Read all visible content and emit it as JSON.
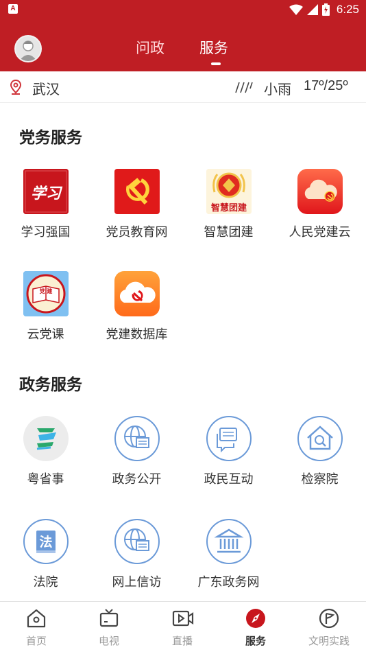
{
  "status_bar": {
    "time": "6:25",
    "app_icon": "A"
  },
  "nav": {
    "tabs": [
      {
        "label": "问政",
        "active": false
      },
      {
        "label": "服务",
        "active": true
      }
    ]
  },
  "location": {
    "city": "武汉"
  },
  "weather": {
    "desc": "小雨",
    "temp": "17º/25º"
  },
  "sections": [
    {
      "title": "党务服务",
      "items": [
        {
          "label": "学习强国",
          "icon": "xuexi-qiangguo-icon",
          "icon_text": "学习"
        },
        {
          "label": "党员教育网",
          "icon": "party-emblem-icon"
        },
        {
          "label": "智慧团建",
          "icon": "youth-league-icon",
          "icon_text": "智慧团建"
        },
        {
          "label": "人民党建云",
          "icon": "party-cloud-icon"
        },
        {
          "label": "云党课",
          "icon": "party-book-icon",
          "icon_text": "党 建"
        },
        {
          "label": "党建数据库",
          "icon": "party-database-icon"
        }
      ]
    },
    {
      "title": "政务服务",
      "items": [
        {
          "label": "粤省事",
          "icon": "yue-sheng-shi-icon"
        },
        {
          "label": "政务公开",
          "icon": "globe-document-icon"
        },
        {
          "label": "政民互动",
          "icon": "chat-bubbles-icon"
        },
        {
          "label": "检察院",
          "icon": "house-search-icon"
        },
        {
          "label": "法院",
          "icon": "law-book-icon",
          "icon_text": "法"
        },
        {
          "label": "网上信访",
          "icon": "globe-message-icon"
        },
        {
          "label": "广东政务网",
          "icon": "government-building-icon"
        }
      ]
    }
  ],
  "bottom_nav": [
    {
      "label": "首页",
      "icon": "home-icon",
      "active": false
    },
    {
      "label": "电视",
      "icon": "tv-icon",
      "active": false
    },
    {
      "label": "直播",
      "icon": "live-video-icon",
      "active": false
    },
    {
      "label": "服务",
      "icon": "compass-icon",
      "active": true
    },
    {
      "label": "文明实践",
      "icon": "flag-icon",
      "active": false
    }
  ],
  "colors": {
    "brand_red": "#bf1e24",
    "icon_blue": "#6b9ad8",
    "text": "#333333",
    "muted": "#999999"
  }
}
